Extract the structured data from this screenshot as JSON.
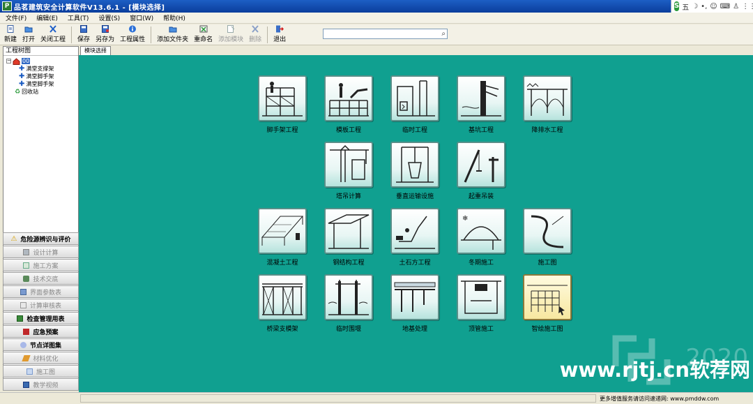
{
  "window": {
    "title": "品茗建筑安全计算软件V13.6.1 - [模块选择]",
    "app_icon_text": "P"
  },
  "ime": {
    "label": "五"
  },
  "menu": [
    "文件(F)",
    "编辑(E)",
    "工具(T)",
    "设置(S)",
    "窗口(W)",
    "帮助(H)"
  ],
  "toolbar": {
    "new": "新建",
    "open": "打开",
    "close_project": "关闭工程",
    "save": "保存",
    "save_as": "另存为",
    "project_props": "工程属性",
    "add_folder": "添加文件夹",
    "rename": "重命名",
    "add_module": "添加模块",
    "delete": "删除",
    "exit": "退出",
    "search_value": ""
  },
  "left_panel": {
    "title": "工程树图",
    "tree": {
      "root": "00",
      "children": [
        "满堂支撑架",
        "满堂脚手架",
        "满堂脚手架"
      ],
      "recycle": "回收站"
    }
  },
  "nav": [
    {
      "label": "危险源辨识与评价",
      "icon": "warning-icon",
      "style": "bold"
    },
    {
      "label": "设计计算",
      "icon": "calc-icon",
      "style": "dim"
    },
    {
      "label": "施工方案",
      "icon": "doc-icon",
      "style": "dim"
    },
    {
      "label": "技术交底",
      "icon": "handshake-icon",
      "style": "dim"
    },
    {
      "label": "界面参数表",
      "icon": "table-icon",
      "style": "dim"
    },
    {
      "label": "计算审核表",
      "icon": "form-icon",
      "style": "dim"
    },
    {
      "label": "检查管理用表",
      "icon": "check-icon",
      "style": "bold"
    },
    {
      "label": "应急预案",
      "icon": "book-icon",
      "style": "bold"
    },
    {
      "label": "节点详图集",
      "icon": "disk-icon",
      "style": "bold"
    },
    {
      "label": "材料优化",
      "icon": "pencil-icon",
      "style": "dim"
    },
    {
      "label": "施工图",
      "icon": "drawing-icon",
      "style": "dim"
    },
    {
      "label": "教学视频",
      "icon": "video-icon",
      "style": "dim"
    }
  ],
  "tab": {
    "label": "模块选择"
  },
  "modules": [
    [
      "脚手架工程",
      "模板工程",
      "临时工程",
      "基坑工程",
      "降排水工程"
    ],
    [
      "塔吊计算",
      "垂直运输设施",
      "起重吊装"
    ],
    [
      "混凝土工程",
      "钢结构工程",
      "土石方工程",
      "冬期施工",
      "施工图"
    ],
    [
      "桥梁支模架",
      "临时围堰",
      "地基处理",
      "顶管施工",
      "智绘施工图"
    ]
  ],
  "watermark": {
    "year": "2020",
    "site": "www.rjtj.cn软荐网"
  },
  "status": {
    "text": "更多增值服务请访问速递网: www.pmddw.com"
  }
}
